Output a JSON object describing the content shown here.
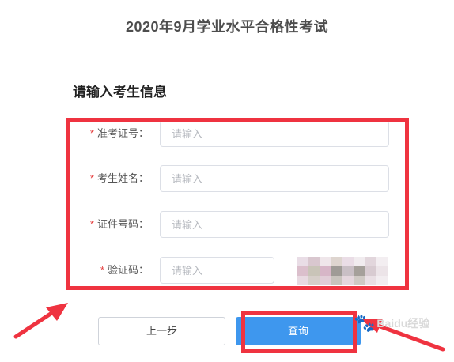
{
  "header": {
    "title": "2020年9月学业水平合格性考试"
  },
  "form": {
    "section_title": "请输入考生信息",
    "required_mark": "*",
    "fields": [
      {
        "label": "准考证号：",
        "placeholder": "请输入",
        "value": ""
      },
      {
        "label": "考生姓名：",
        "placeholder": "请输入",
        "value": ""
      },
      {
        "label": "证件号码：",
        "placeholder": "请输入",
        "value": ""
      },
      {
        "label": "验证码：",
        "placeholder": "请输入",
        "value": ""
      }
    ]
  },
  "buttons": {
    "back_label": "上一步",
    "query_label": "查询"
  },
  "annotations": {
    "highlight_color": "#ef3340"
  },
  "watermark": {
    "text": "Baidu经验"
  },
  "colors": {
    "primary": "#3e97ee",
    "required": "#e63f3f"
  }
}
